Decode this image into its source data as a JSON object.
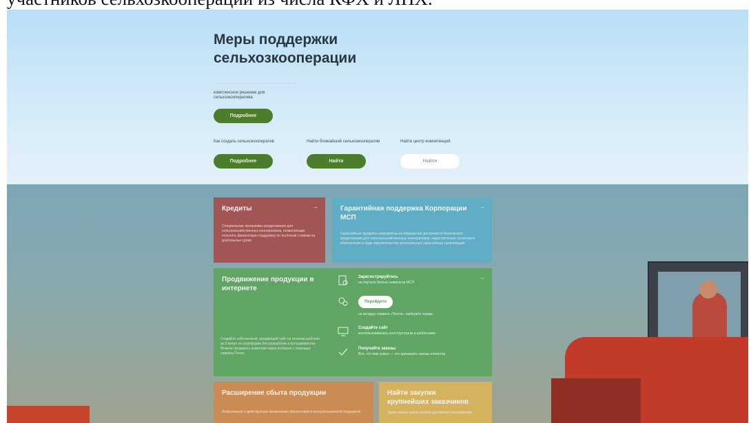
{
  "document_caption": "участников сельхозкооперации из числа КФХ и ЛПХ.",
  "hero": {
    "title": "Меры поддержки сельхозкооперации",
    "subtitle": "комплексное решение для сельхозкооператива",
    "primary_button": "Подробнее",
    "items": [
      {
        "label": "Как создать сельхозкооператив",
        "button": "Подробнее"
      },
      {
        "label": "Найти ближайший сельхозкооператив",
        "button": "Найти"
      },
      {
        "label": "Найти центр компетенций",
        "button": "Найти"
      }
    ]
  },
  "cards": {
    "credits": {
      "title": "Кредиты",
      "body": "Специальные программы кредитования для сельскохозяйственных кооперативов, позволяющие получить финансовую поддержку по льготным ставкам на длительные сроки.",
      "arrow": "→"
    },
    "guarantee": {
      "title": "Гарантийная поддержка Корпорации МСП",
      "body": "Гарантийные продукты направлены на повышение доступности банковского кредитования для сельскохозяйственных кооперативов, недостаточного залогового обеспечения в виде поручительства региональных гарантийных организаций.",
      "arrow": "→"
    },
    "online": {
      "title": "Продвижение продукции в интернете",
      "body": "Создайте собственный, продающий сайт на готовом шаблоне за 5 минут на платформе без разработки и программистов. Можете продавать клиентам через интернет с помощью сервиса Почта.",
      "arrow": "→",
      "steps": [
        {
          "title": "Зарегистрируйтесь",
          "text": "на портале Бизнес-навигатор МСП"
        },
        {
          "button": "Перейдите",
          "text": "на вкладку сервиса «Почта», выберите сервис"
        },
        {
          "title": "Создайте сайт",
          "text": "воспользовавшись конструктором и шаблонами"
        },
        {
          "title": "Получайте заказы",
          "text": "Всё, что вам нужно — это принимать заказы клиентов"
        }
      ]
    },
    "sales": {
      "title": "Расширение сбыта продукции",
      "body": "Информация о действующих механизмах финансовой и консультационной поддержки"
    },
    "purchases": {
      "title": "Найти закупки крупнейших заказчиков",
      "body": "Здесь можно найти закупки для вашего кооператива"
    }
  },
  "colors": {
    "hero_bg": "#cfe7f7",
    "green_button": "#4c7d2c",
    "credits_card": "#a64d4d",
    "guarantee_card": "#5eaec6",
    "online_card": "#5da560",
    "sales_card": "#cf8a4f",
    "purchases_card": "#d9b35a"
  },
  "icons": [
    "arrow-right-icon",
    "document-person-icon",
    "chat-icon",
    "monitor-icon",
    "check-icon"
  ]
}
